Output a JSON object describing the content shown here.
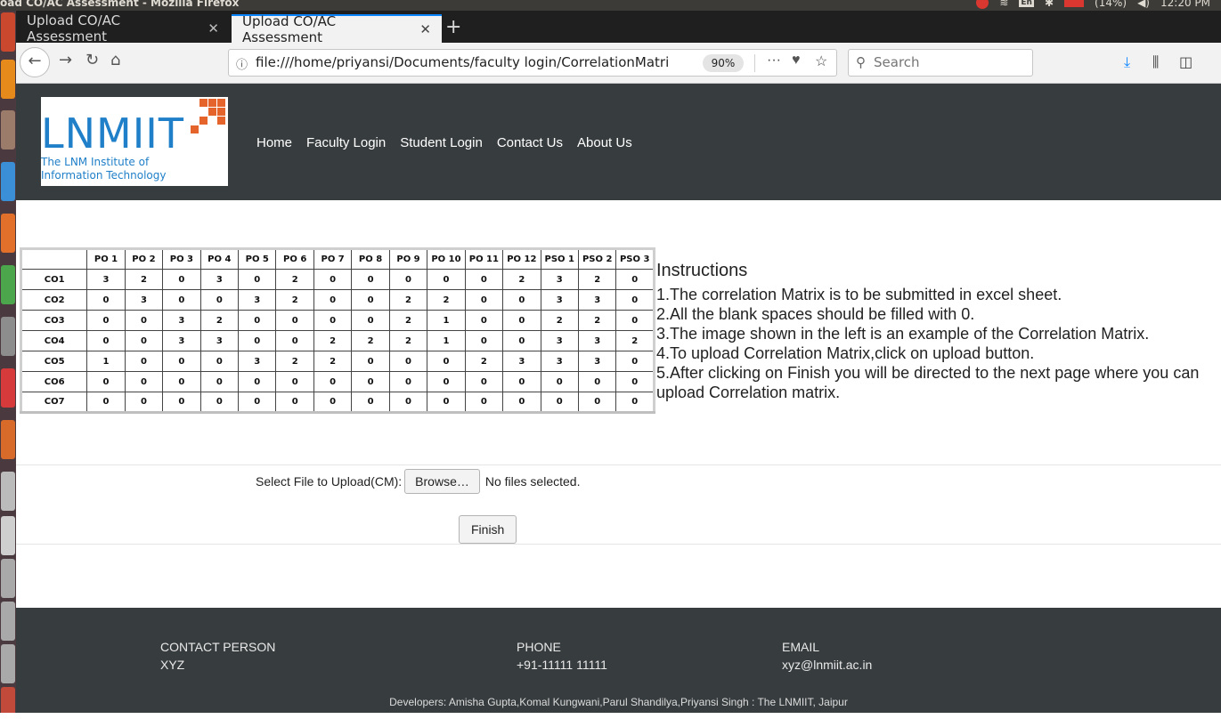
{
  "os": {
    "window_title": "oad CO/AC Assessment - Mozilla Firefox",
    "keyboard": "En",
    "battery": "(14%)",
    "time": "12:20 PM"
  },
  "browser": {
    "tabs": [
      {
        "label": "Upload CO/AC Assessment",
        "active": false
      },
      {
        "label": "Upload CO/AC Assessment",
        "active": true
      }
    ],
    "new_tab": "+",
    "url": "file:///home/priyansi/Documents/faculty login/CorrelationMatri",
    "zoom": "90%",
    "search_placeholder": "Search"
  },
  "header": {
    "logo_main": "LNMIIT",
    "logo_sub1": "The LNM Institute of",
    "logo_sub2": "Information Technology",
    "nav": [
      "Home",
      "Faculty Login",
      "Student Login",
      "Contact Us",
      "About Us"
    ]
  },
  "matrix": {
    "columns": [
      "PO 1",
      "PO 2",
      "PO 3",
      "PO 4",
      "PO 5",
      "PO 6",
      "PO 7",
      "PO 8",
      "PO 9",
      "PO 10",
      "PO 11",
      "PO 12",
      "PSO 1",
      "PSO 2",
      "PSO 3"
    ],
    "rows": [
      {
        "label": "CO1",
        "values": [
          "3",
          "2",
          "0",
          "3",
          "0",
          "2",
          "0",
          "0",
          "0",
          "0",
          "0",
          "2",
          "3",
          "2",
          "0"
        ]
      },
      {
        "label": "CO2",
        "values": [
          "0",
          "3",
          "0",
          "0",
          "3",
          "2",
          "0",
          "0",
          "2",
          "2",
          "0",
          "0",
          "3",
          "3",
          "0"
        ]
      },
      {
        "label": "CO3",
        "values": [
          "0",
          "0",
          "3",
          "2",
          "0",
          "0",
          "0",
          "0",
          "2",
          "1",
          "0",
          "0",
          "2",
          "2",
          "0"
        ]
      },
      {
        "label": "CO4",
        "values": [
          "0",
          "0",
          "3",
          "3",
          "0",
          "0",
          "2",
          "2",
          "2",
          "1",
          "0",
          "0",
          "3",
          "3",
          "2"
        ]
      },
      {
        "label": "CO5",
        "values": [
          "1",
          "0",
          "0",
          "0",
          "3",
          "2",
          "2",
          "0",
          "0",
          "0",
          "2",
          "3",
          "3",
          "3",
          "0"
        ]
      },
      {
        "label": "CO6",
        "values": [
          "0",
          "0",
          "0",
          "0",
          "0",
          "0",
          "0",
          "0",
          "0",
          "0",
          "0",
          "0",
          "0",
          "0",
          "0"
        ]
      },
      {
        "label": "CO7",
        "values": [
          "0",
          "0",
          "0",
          "0",
          "0",
          "0",
          "0",
          "0",
          "0",
          "0",
          "0",
          "0",
          "0",
          "0",
          "0"
        ]
      }
    ]
  },
  "instructions": {
    "title": "Instructions",
    "lines": [
      "1.The correlation Matrix is to be submitted in excel sheet.",
      "2.All the blank spaces should be filled with 0.",
      "3.The image shown in the left is an example of the Correlation Matrix.",
      "4.To upload Correlation Matrix,click on upload button.",
      "5.After clicking on Finish you will be directed to the next page where you can",
      "upload Correlation matrix."
    ]
  },
  "upload": {
    "label": "Select File to Upload(CM):",
    "browse_label": "Browse…",
    "status": "No files selected.",
    "finish_label": "Finish"
  },
  "footer": {
    "contact_heading": "CONTACT PERSON",
    "contact_value": "XYZ",
    "phone_heading": "PHONE",
    "phone_value": "+91-11111 11111",
    "email_heading": "EMAIL",
    "email_value": "xyz@lnmiit.ac.in",
    "developers": "Developers: Amisha Gupta,Komal Kungwani,Parul Shandilya,Priyansi Singh : The LNMIIT, Jaipur"
  },
  "colors": {
    "header_bg": "#373c3e",
    "logo_blue": "#1f7fc8",
    "logo_orange": "#e5642b",
    "tab_accent": "#0a84ff"
  }
}
